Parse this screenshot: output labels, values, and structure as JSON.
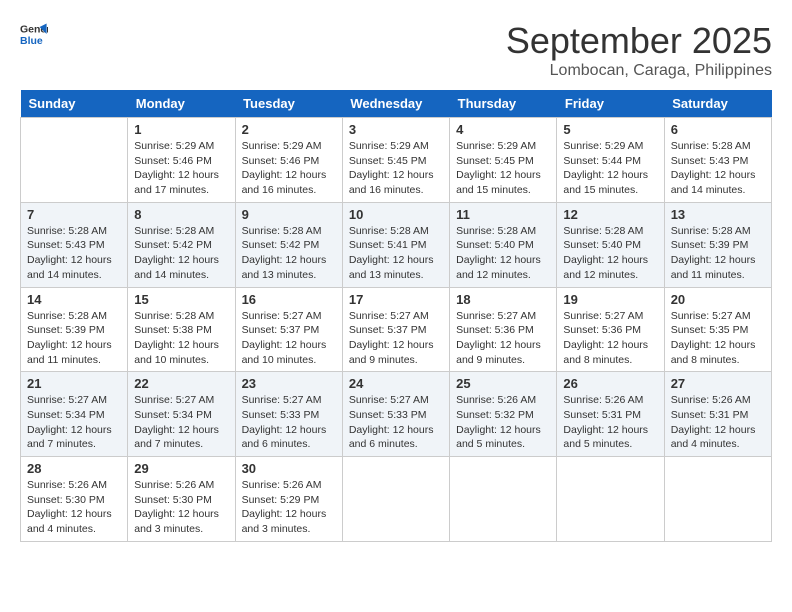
{
  "logo": {
    "line1": "General",
    "line2": "Blue"
  },
  "title": "September 2025",
  "location": "Lombocan, Caraga, Philippines",
  "days_of_week": [
    "Sunday",
    "Monday",
    "Tuesday",
    "Wednesday",
    "Thursday",
    "Friday",
    "Saturday"
  ],
  "weeks": [
    [
      {
        "day": "",
        "sunrise": "",
        "sunset": "",
        "daylight": ""
      },
      {
        "day": "1",
        "sunrise": "Sunrise: 5:29 AM",
        "sunset": "Sunset: 5:46 PM",
        "daylight": "Daylight: 12 hours and 17 minutes."
      },
      {
        "day": "2",
        "sunrise": "Sunrise: 5:29 AM",
        "sunset": "Sunset: 5:46 PM",
        "daylight": "Daylight: 12 hours and 16 minutes."
      },
      {
        "day": "3",
        "sunrise": "Sunrise: 5:29 AM",
        "sunset": "Sunset: 5:45 PM",
        "daylight": "Daylight: 12 hours and 16 minutes."
      },
      {
        "day": "4",
        "sunrise": "Sunrise: 5:29 AM",
        "sunset": "Sunset: 5:45 PM",
        "daylight": "Daylight: 12 hours and 15 minutes."
      },
      {
        "day": "5",
        "sunrise": "Sunrise: 5:29 AM",
        "sunset": "Sunset: 5:44 PM",
        "daylight": "Daylight: 12 hours and 15 minutes."
      },
      {
        "day": "6",
        "sunrise": "Sunrise: 5:28 AM",
        "sunset": "Sunset: 5:43 PM",
        "daylight": "Daylight: 12 hours and 14 minutes."
      }
    ],
    [
      {
        "day": "7",
        "sunrise": "Sunrise: 5:28 AM",
        "sunset": "Sunset: 5:43 PM",
        "daylight": "Daylight: 12 hours and 14 minutes."
      },
      {
        "day": "8",
        "sunrise": "Sunrise: 5:28 AM",
        "sunset": "Sunset: 5:42 PM",
        "daylight": "Daylight: 12 hours and 14 minutes."
      },
      {
        "day": "9",
        "sunrise": "Sunrise: 5:28 AM",
        "sunset": "Sunset: 5:42 PM",
        "daylight": "Daylight: 12 hours and 13 minutes."
      },
      {
        "day": "10",
        "sunrise": "Sunrise: 5:28 AM",
        "sunset": "Sunset: 5:41 PM",
        "daylight": "Daylight: 12 hours and 13 minutes."
      },
      {
        "day": "11",
        "sunrise": "Sunrise: 5:28 AM",
        "sunset": "Sunset: 5:40 PM",
        "daylight": "Daylight: 12 hours and 12 minutes."
      },
      {
        "day": "12",
        "sunrise": "Sunrise: 5:28 AM",
        "sunset": "Sunset: 5:40 PM",
        "daylight": "Daylight: 12 hours and 12 minutes."
      },
      {
        "day": "13",
        "sunrise": "Sunrise: 5:28 AM",
        "sunset": "Sunset: 5:39 PM",
        "daylight": "Daylight: 12 hours and 11 minutes."
      }
    ],
    [
      {
        "day": "14",
        "sunrise": "Sunrise: 5:28 AM",
        "sunset": "Sunset: 5:39 PM",
        "daylight": "Daylight: 12 hours and 11 minutes."
      },
      {
        "day": "15",
        "sunrise": "Sunrise: 5:28 AM",
        "sunset": "Sunset: 5:38 PM",
        "daylight": "Daylight: 12 hours and 10 minutes."
      },
      {
        "day": "16",
        "sunrise": "Sunrise: 5:27 AM",
        "sunset": "Sunset: 5:37 PM",
        "daylight": "Daylight: 12 hours and 10 minutes."
      },
      {
        "day": "17",
        "sunrise": "Sunrise: 5:27 AM",
        "sunset": "Sunset: 5:37 PM",
        "daylight": "Daylight: 12 hours and 9 minutes."
      },
      {
        "day": "18",
        "sunrise": "Sunrise: 5:27 AM",
        "sunset": "Sunset: 5:36 PM",
        "daylight": "Daylight: 12 hours and 9 minutes."
      },
      {
        "day": "19",
        "sunrise": "Sunrise: 5:27 AM",
        "sunset": "Sunset: 5:36 PM",
        "daylight": "Daylight: 12 hours and 8 minutes."
      },
      {
        "day": "20",
        "sunrise": "Sunrise: 5:27 AM",
        "sunset": "Sunset: 5:35 PM",
        "daylight": "Daylight: 12 hours and 8 minutes."
      }
    ],
    [
      {
        "day": "21",
        "sunrise": "Sunrise: 5:27 AM",
        "sunset": "Sunset: 5:34 PM",
        "daylight": "Daylight: 12 hours and 7 minutes."
      },
      {
        "day": "22",
        "sunrise": "Sunrise: 5:27 AM",
        "sunset": "Sunset: 5:34 PM",
        "daylight": "Daylight: 12 hours and 7 minutes."
      },
      {
        "day": "23",
        "sunrise": "Sunrise: 5:27 AM",
        "sunset": "Sunset: 5:33 PM",
        "daylight": "Daylight: 12 hours and 6 minutes."
      },
      {
        "day": "24",
        "sunrise": "Sunrise: 5:27 AM",
        "sunset": "Sunset: 5:33 PM",
        "daylight": "Daylight: 12 hours and 6 minutes."
      },
      {
        "day": "25",
        "sunrise": "Sunrise: 5:26 AM",
        "sunset": "Sunset: 5:32 PM",
        "daylight": "Daylight: 12 hours and 5 minutes."
      },
      {
        "day": "26",
        "sunrise": "Sunrise: 5:26 AM",
        "sunset": "Sunset: 5:31 PM",
        "daylight": "Daylight: 12 hours and 5 minutes."
      },
      {
        "day": "27",
        "sunrise": "Sunrise: 5:26 AM",
        "sunset": "Sunset: 5:31 PM",
        "daylight": "Daylight: 12 hours and 4 minutes."
      }
    ],
    [
      {
        "day": "28",
        "sunrise": "Sunrise: 5:26 AM",
        "sunset": "Sunset: 5:30 PM",
        "daylight": "Daylight: 12 hours and 4 minutes."
      },
      {
        "day": "29",
        "sunrise": "Sunrise: 5:26 AM",
        "sunset": "Sunset: 5:30 PM",
        "daylight": "Daylight: 12 hours and 3 minutes."
      },
      {
        "day": "30",
        "sunrise": "Sunrise: 5:26 AM",
        "sunset": "Sunset: 5:29 PM",
        "daylight": "Daylight: 12 hours and 3 minutes."
      },
      {
        "day": "",
        "sunrise": "",
        "sunset": "",
        "daylight": ""
      },
      {
        "day": "",
        "sunrise": "",
        "sunset": "",
        "daylight": ""
      },
      {
        "day": "",
        "sunrise": "",
        "sunset": "",
        "daylight": ""
      },
      {
        "day": "",
        "sunrise": "",
        "sunset": "",
        "daylight": ""
      }
    ]
  ]
}
